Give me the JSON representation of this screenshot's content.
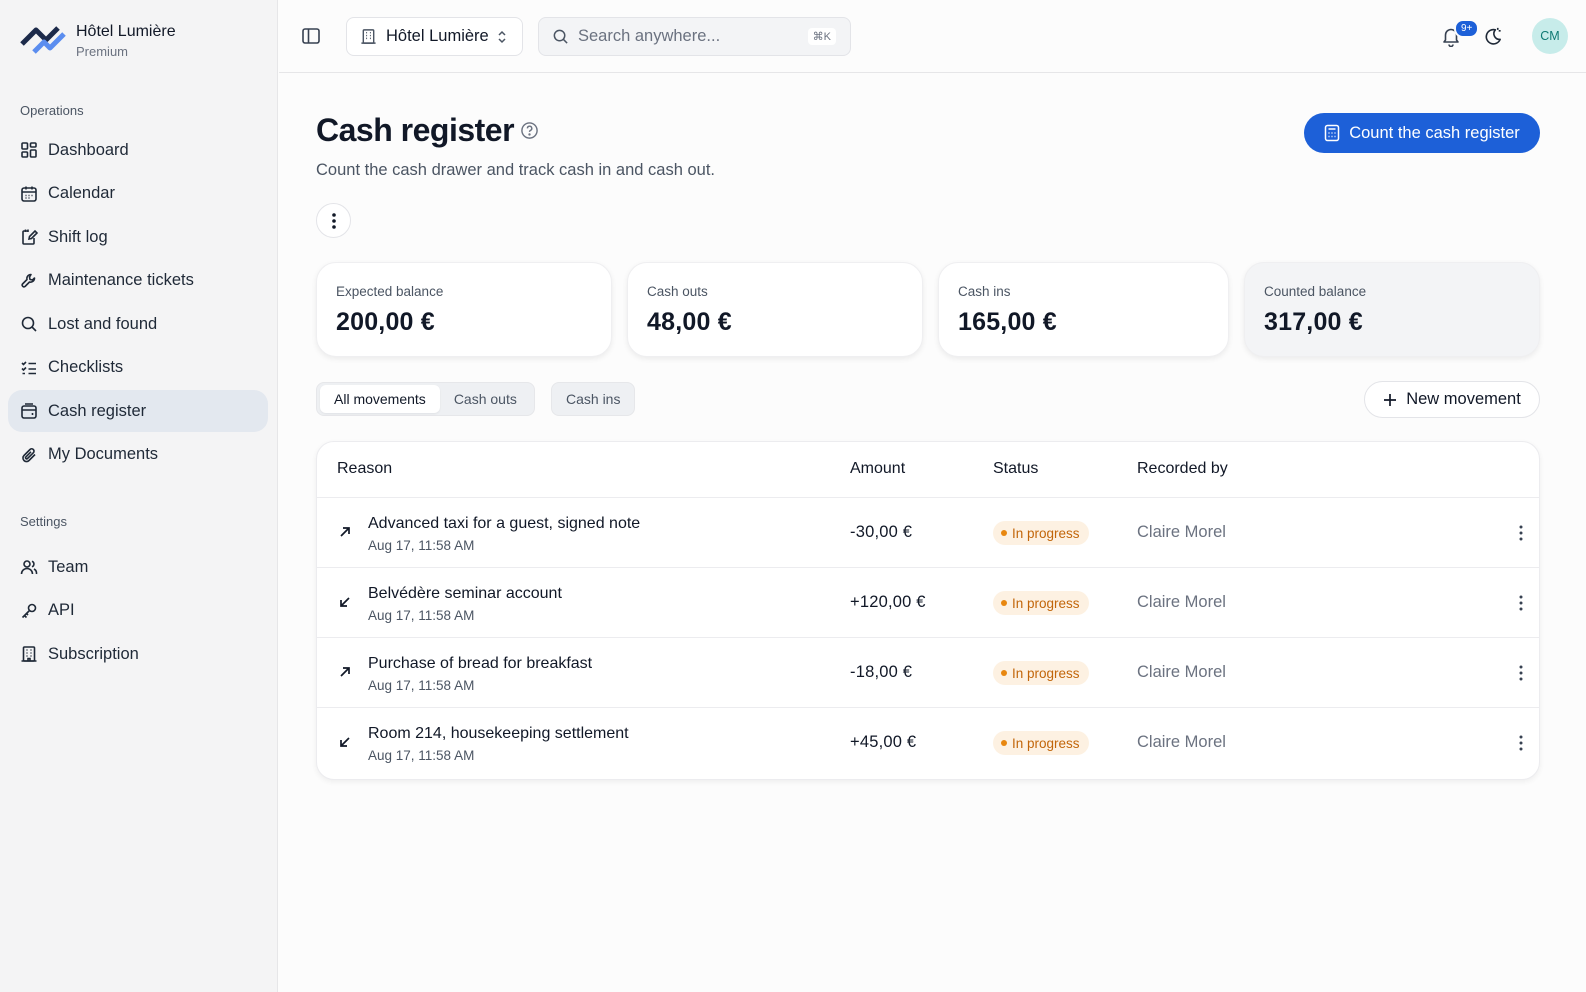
{
  "brand": {
    "name": "Hôtel Lumière",
    "plan": "Premium"
  },
  "sidebar": {
    "operations_label": "Operations",
    "operations": [
      {
        "label": "Dashboard",
        "icon": "dashboard-icon"
      },
      {
        "label": "Calendar",
        "icon": "calendar-icon"
      },
      {
        "label": "Shift log",
        "icon": "shift-log-icon"
      },
      {
        "label": "Maintenance tickets",
        "icon": "wrench-icon"
      },
      {
        "label": "Lost and found",
        "icon": "search-icon"
      },
      {
        "label": "Checklists",
        "icon": "checklist-icon"
      },
      {
        "label": "Cash register",
        "icon": "cash-register-icon",
        "active": true
      },
      {
        "label": "My Documents",
        "icon": "paperclip-icon"
      }
    ],
    "settings_label": "Settings",
    "settings": [
      {
        "label": "Team",
        "icon": "team-icon"
      },
      {
        "label": "API",
        "icon": "key-icon"
      },
      {
        "label": "Subscription",
        "icon": "building-icon"
      }
    ]
  },
  "topbar": {
    "hotel_select": "Hôtel Lumière",
    "search_placeholder": "Search anywhere...",
    "search_shortcut": "⌘K",
    "notification_badge": "9+",
    "avatar_initials": "CM"
  },
  "page": {
    "title": "Cash register",
    "subtitle": "Count the cash drawer and track cash in and cash out.",
    "primary_action": "Count the cash register"
  },
  "cards": [
    {
      "label": "Expected balance",
      "value": "200,00 €"
    },
    {
      "label": "Cash outs",
      "value": "48,00 €"
    },
    {
      "label": "Cash ins",
      "value": "165,00 €"
    },
    {
      "label": "Counted balance",
      "value": "317,00 €"
    }
  ],
  "tabs": {
    "all": "All movements",
    "outs": "Cash outs",
    "ins": "Cash ins"
  },
  "new_movement": "New movement",
  "table": {
    "headers": {
      "reason": "Reason",
      "amount": "Amount",
      "status": "Status",
      "recorded_by": "Recorded by"
    },
    "rows": [
      {
        "direction": "out",
        "reason": "Advanced taxi for a guest, signed note",
        "date": "Aug 17, 11:58 AM",
        "amount": "-30,00 €",
        "status": "In progress",
        "recorded_by": "Claire Morel"
      },
      {
        "direction": "in",
        "reason": "Belvédère seminar account",
        "date": "Aug 17, 11:58 AM",
        "amount": "+120,00 €",
        "status": "In progress",
        "recorded_by": "Claire Morel"
      },
      {
        "direction": "out",
        "reason": "Purchase of bread for breakfast",
        "date": "Aug 17, 11:58 AM",
        "amount": "-18,00 €",
        "status": "In progress",
        "recorded_by": "Claire Morel"
      },
      {
        "direction": "in",
        "reason": "Room 214, housekeeping settlement",
        "date": "Aug 17, 11:58 AM",
        "amount": "+45,00 €",
        "status": "In progress",
        "recorded_by": "Claire Morel"
      }
    ]
  },
  "colors": {
    "accent": "#1d60d8",
    "status_progress": "#c2660a",
    "status_progress_bg": "#fdf1e2",
    "avatar_bg": "#c7ecea"
  }
}
